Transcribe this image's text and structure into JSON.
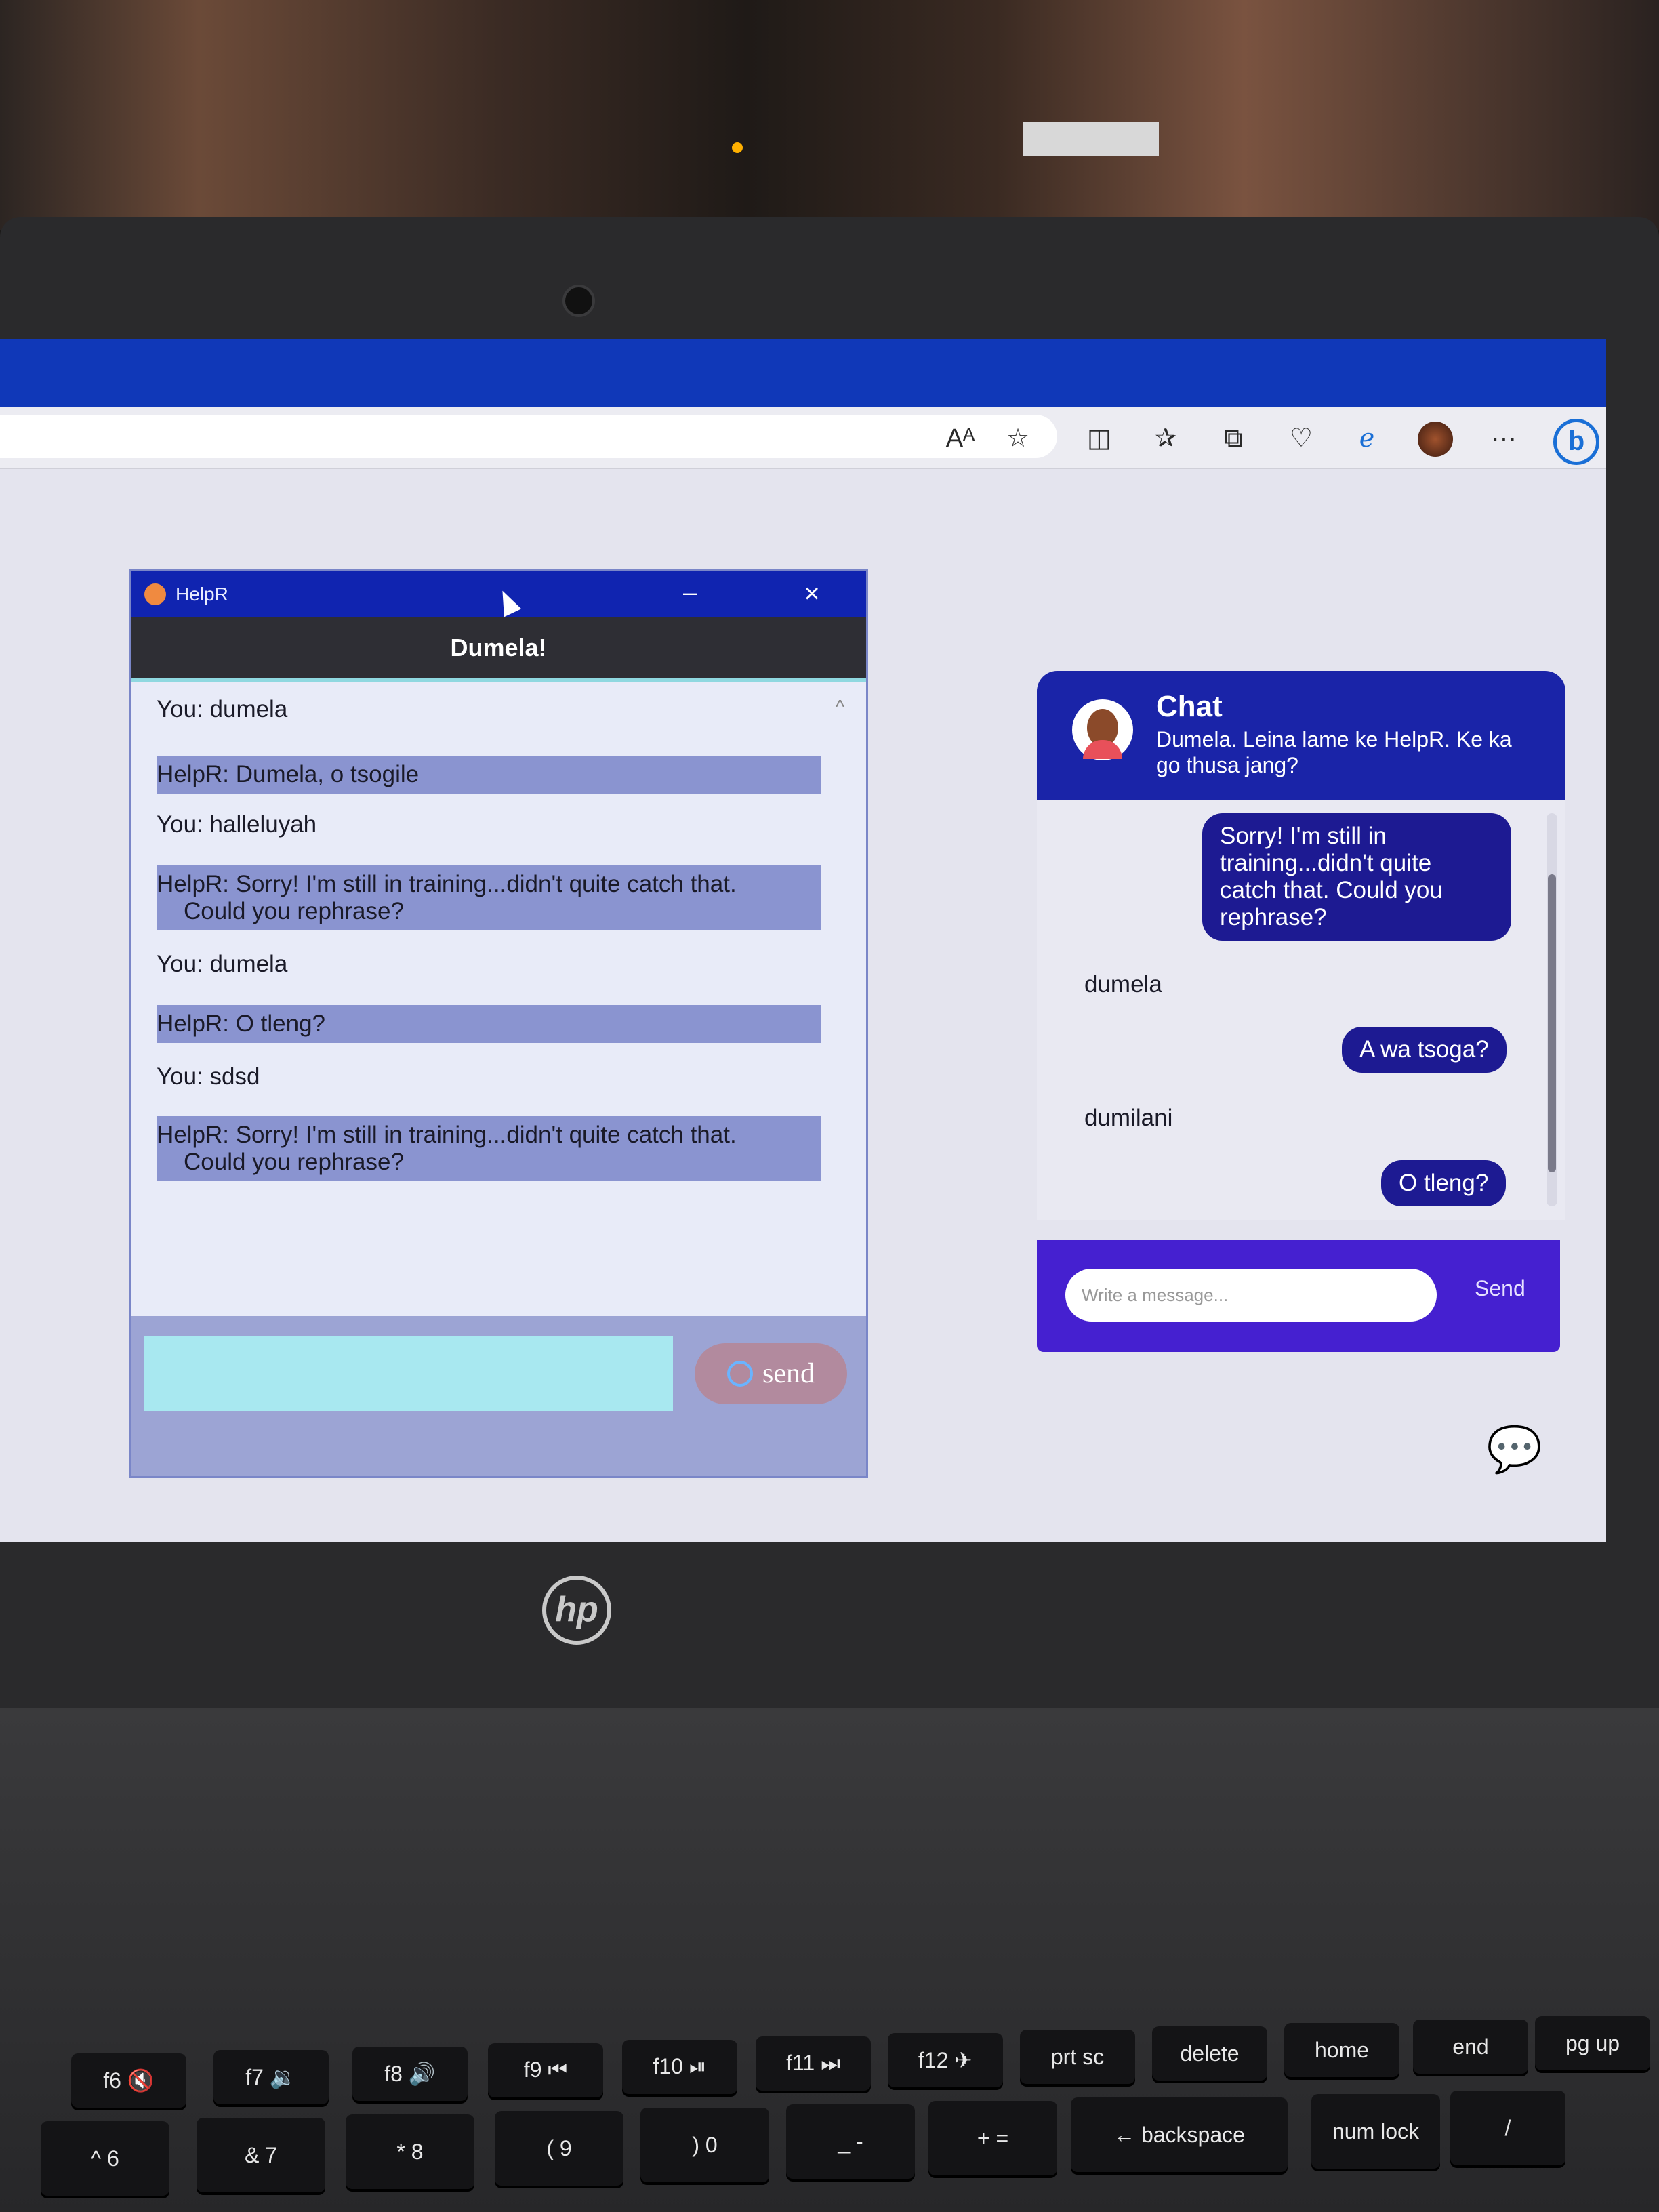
{
  "browser": {
    "toolbar_icons": [
      "read-aloud-icon",
      "favorite-star-icon",
      "split-screen-icon",
      "favorites-list-icon",
      "collections-icon",
      "browser-essentials-icon",
      "internet-explorer-icon",
      "profile-icon",
      "more-icon",
      "bing-icon"
    ],
    "read_aloud": "Aᴬ",
    "more": "···",
    "bing": "b"
  },
  "desktop_app": {
    "title": "HelpR",
    "header": "Dumela!",
    "messages": [
      {
        "text": "You: dumela"
      },
      {
        "text": "HelpR: Dumela, o tsogile"
      },
      {
        "text": "You: halleluyah"
      },
      {
        "text": "HelpR: Sorry! I'm still in training...didn't quite catch that.",
        "cont": "Could you rephrase?"
      },
      {
        "text": "You: dumela"
      },
      {
        "text": "HelpR: O tleng?"
      },
      {
        "text": "You: sdsd"
      },
      {
        "text": "HelpR: Sorry! I'm still in training...didn't quite catch that.",
        "cont": "Could you rephrase?"
      }
    ],
    "input_value": "",
    "send_label": "send"
  },
  "web_chat": {
    "title": "Chat",
    "subtitle": "Dumela. Leina lame ke HelpR. Ke ka go thusa jang?",
    "messages": [
      {
        "from": "bot",
        "text": "Sorry! I'm still in training...didn't quite catch that. Could you rephrase?"
      },
      {
        "from": "user",
        "text": "dumela"
      },
      {
        "from": "bot",
        "text": "A wa tsoga?"
      },
      {
        "from": "user",
        "text": "dumilani"
      },
      {
        "from": "bot",
        "text": "O tleng?"
      }
    ],
    "input_placeholder": "Write a message...",
    "send_label": "Send"
  },
  "laptop": {
    "brand": "hp",
    "keys_row1": [
      "f6 🔇",
      "f7 🔉",
      "f8 🔊",
      "f9 ⏮",
      "f10 ⏯",
      "f11 ⏭",
      "f12 ✈",
      "prt sc",
      "delete",
      "home",
      "end",
      "pg up"
    ],
    "keys_row2": [
      "^ 6",
      "& 7",
      "* 8",
      "( 9",
      ") 0",
      "_ -",
      "+ =",
      "← backspace",
      "num lock",
      "/"
    ]
  },
  "colors": {
    "app_titlebar": "#1024b0",
    "widget_head": "#1a24a8",
    "widget_foot": "#4520d0",
    "bot_bubble": "#1d1a92"
  }
}
